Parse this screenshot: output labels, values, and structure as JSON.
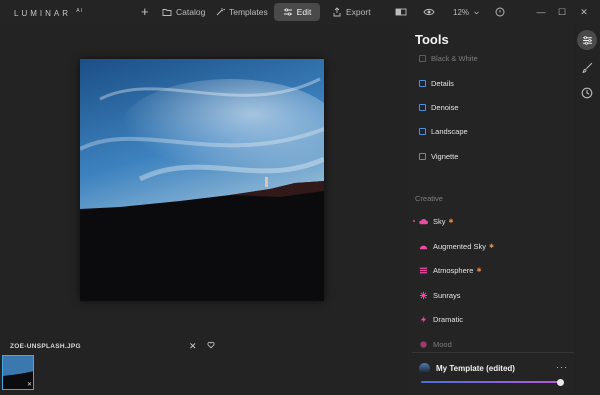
{
  "app": {
    "logo": "LUMINAR",
    "logo_suffix": "AI"
  },
  "toolbar": {
    "add_label": "+",
    "catalog_label": "Catalog",
    "templates_label": "Templates",
    "edit_label": "Edit",
    "export_label": "Export",
    "zoom_value": "12%"
  },
  "window_controls": {
    "minimize": "—",
    "maximize": "☐",
    "close": "✕"
  },
  "image": {
    "filename": "ZOE-UNSPLASH.JPG"
  },
  "tools": {
    "title": "Tools",
    "essentials_items": [
      {
        "label": "Black & White",
        "icon": "black-white-icon"
      },
      {
        "label": "Details",
        "icon": "details-icon"
      },
      {
        "label": "Denoise",
        "icon": "denoise-icon"
      },
      {
        "label": "Landscape",
        "icon": "landscape-icon"
      },
      {
        "label": "Vignette",
        "icon": "vignette-icon"
      }
    ],
    "creative_label": "Creative",
    "creative_items": [
      {
        "label": "Sky",
        "icon": "sky-icon",
        "ai": true
      },
      {
        "label": "Augmented Sky",
        "icon": "augmented-sky-icon",
        "ai": true
      },
      {
        "label": "Atmosphere",
        "icon": "atmosphere-icon",
        "ai": true
      },
      {
        "label": "Sunrays",
        "icon": "sunrays-icon",
        "ai": false
      },
      {
        "label": "Dramatic",
        "icon": "dramatic-icon",
        "ai": false
      },
      {
        "label": "Mood",
        "icon": "mood-icon",
        "ai": false
      }
    ],
    "ai_marker": "✱"
  },
  "template": {
    "name": "My Template (edited)",
    "more_label": "···",
    "amount": 1.0
  },
  "colors": {
    "accent_blue": "#4a90e2",
    "creative_pink": "#ec4ba0",
    "ai_star": "#e58a46",
    "thumb_border": "#4aa7e6"
  }
}
